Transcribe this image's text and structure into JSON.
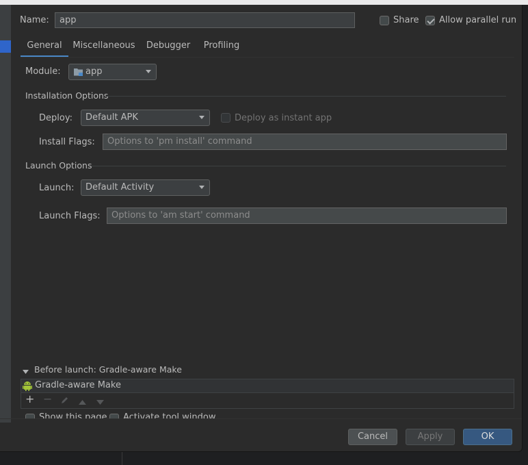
{
  "name_field": {
    "label": "Name:",
    "value": "app"
  },
  "share": {
    "label": "Share",
    "checked": false
  },
  "allow_parallel": {
    "label": "Allow parallel run",
    "checked": true
  },
  "tabs": [
    {
      "label": "General",
      "active": true
    },
    {
      "label": "Miscellaneous",
      "active": false
    },
    {
      "label": "Debugger",
      "active": false
    },
    {
      "label": "Profiling",
      "active": false
    }
  ],
  "module": {
    "label": "Module:",
    "value": "app"
  },
  "installation": {
    "title": "Installation Options",
    "deploy_label": "Deploy:",
    "deploy_value": "Default APK",
    "instant_label": "Deploy as instant app",
    "flags_label": "Install Flags:",
    "flags_placeholder": "Options to 'pm install' command"
  },
  "launch": {
    "title": "Launch Options",
    "launch_label": "Launch:",
    "launch_value": "Default Activity",
    "flags_label": "Launch Flags:",
    "flags_placeholder": "Options to 'am start' command"
  },
  "before_launch": {
    "title": "Before launch: Gradle-aware Make",
    "task": "Gradle-aware Make",
    "show_page_label": "Show this page",
    "activate_label": "Activate tool window"
  },
  "buttons": {
    "cancel": "Cancel",
    "apply": "Apply",
    "ok": "OK"
  },
  "colors": {
    "accent": "#4a88c7",
    "primary_button": "#365880",
    "android_green": "#a4c639"
  }
}
